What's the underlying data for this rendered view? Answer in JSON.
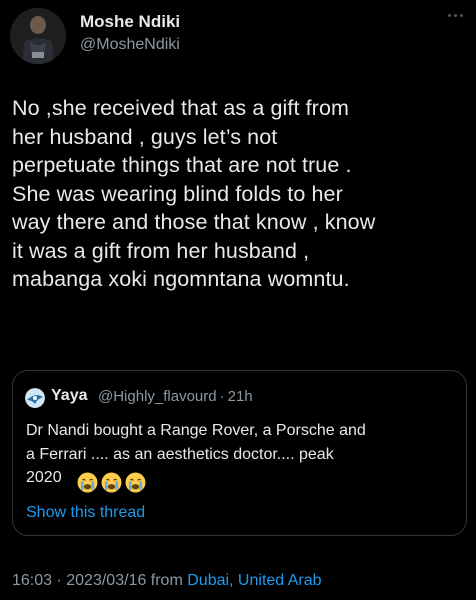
{
  "author": {
    "display_name": "Moshe Ndiki",
    "handle": "@MosheNdiki",
    "avatar_icon": "profile-photo"
  },
  "more_icon": "more-dots-icon",
  "tweet": {
    "text": "No ,she received that as a gift from\nher husband , guys let’s not\nperpetuate things that are not true .\nShe was wearing blind folds to her\nway there and those that know , know\nit was a gift from her husband ,\nmabanga xoki ngomntana womntu."
  },
  "quoted_tweet": {
    "display_name": "Yaya",
    "handle": "@Highly_flavourd",
    "separator": "·",
    "time": "21h",
    "text": "Dr Nandi bought a Range Rover, a Porsche and\na Ferrari .... as an aesthetics doctor.... peak\n2020",
    "emojis": [
      "crying-face-icon",
      "crying-face-icon",
      "crying-face-icon"
    ],
    "show_thread": "Show this thread"
  },
  "meta": {
    "timestamp": "16:03 · 2023/03/16 from",
    "location": "Dubai, United Arab"
  },
  "colors": {
    "background": "#000000",
    "text": "#e7e9ea",
    "secondary": "#8b98a5",
    "link": "#1d9bf0",
    "border": "#2f3336"
  }
}
